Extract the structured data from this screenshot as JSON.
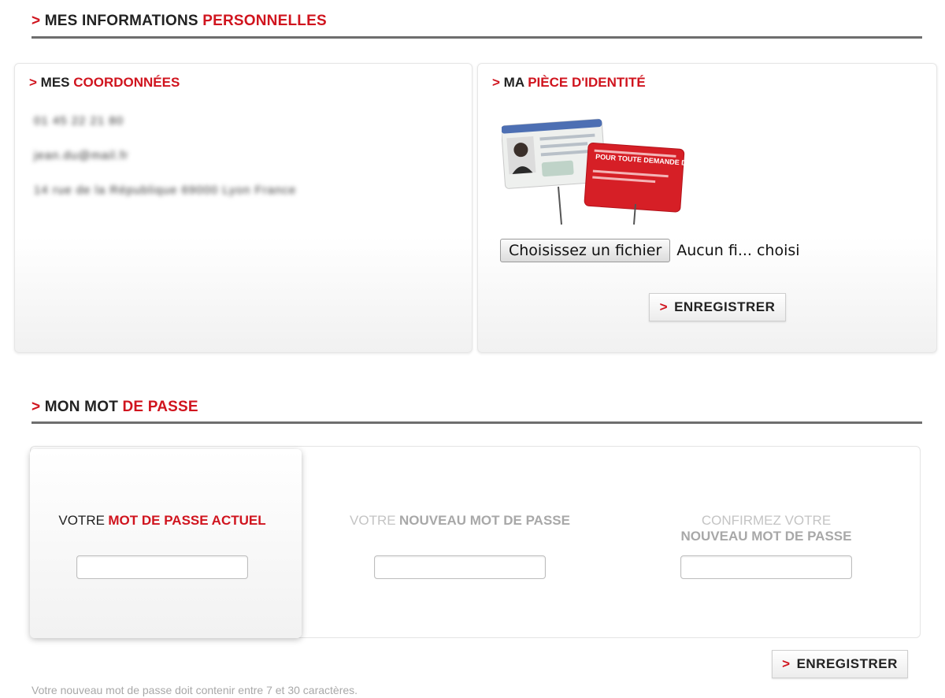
{
  "personal_info": {
    "title_part1": "MES INFORMATIONS",
    "title_part2": "PERSONNELLES"
  },
  "coordinates": {
    "title_part1": "MES",
    "title_part2": "COORDONNÉES",
    "lines": [
      "01 45 22 21 80",
      "jean.du@mail.fr",
      "14 rue de la République 69000 Lyon France"
    ]
  },
  "identity": {
    "title_part1": "MA",
    "title_part2": "PIÈCE D'IDENTITÉ",
    "card_text": "POUR TOUTE DEMANDE DE FINANCEMENT",
    "file_button": "Choisissez un fichier",
    "file_status": "Aucun fi... choisi",
    "save_button": "ENREGISTRER"
  },
  "password": {
    "title_part1": "MON MOT",
    "title_part2": "DE PASSE",
    "current": {
      "prefix": "VOTRE",
      "emph": "MOT DE PASSE ACTUEL",
      "value": ""
    },
    "new": {
      "prefix": "VOTRE",
      "emph": "NOUVEAU MOT DE PASSE",
      "value": ""
    },
    "confirm": {
      "prefix": "CONFIRMEZ VOTRE",
      "emph": "NOUVEAU MOT DE PASSE",
      "value": ""
    },
    "save_button": "ENREGISTRER",
    "note": "Votre nouveau mot de passe doit contenir entre 7 et 30 caractères."
  },
  "colors": {
    "accent": "#d0141e",
    "rule": "#6e6e6e"
  },
  "icons": {
    "arrow": ">"
  }
}
